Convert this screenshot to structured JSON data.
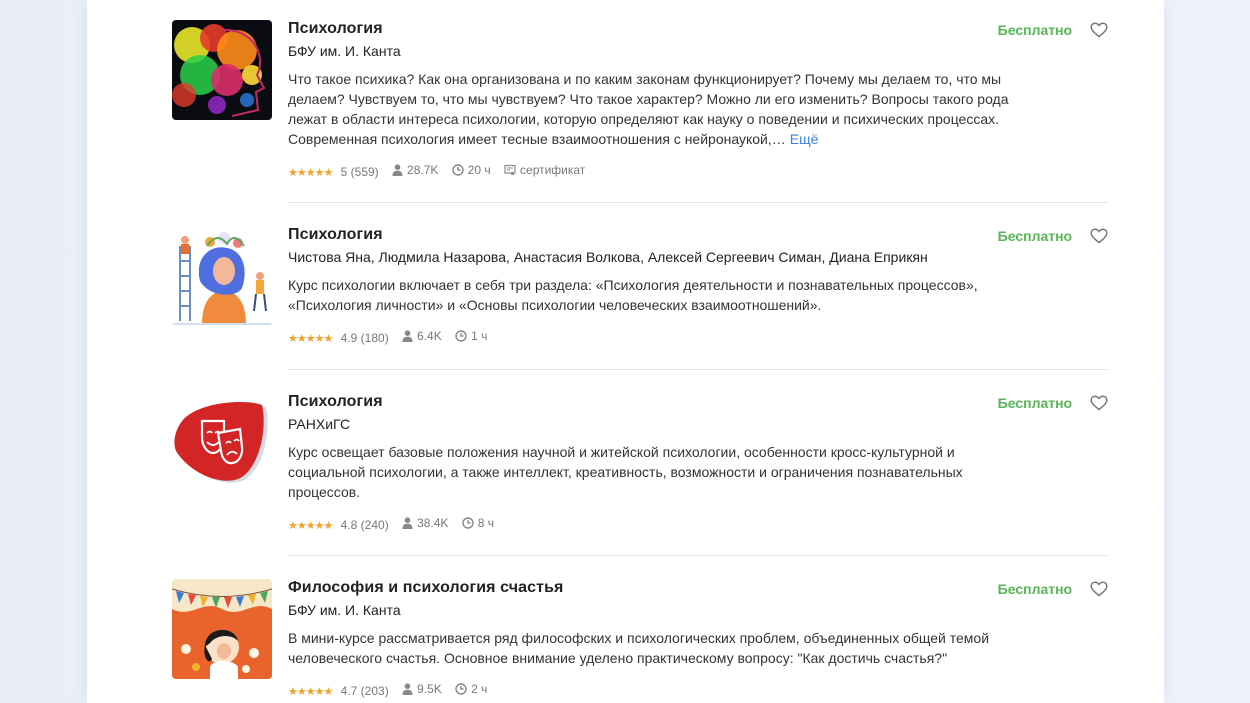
{
  "courses": [
    {
      "title": "Психология",
      "author": "БФУ им. И. Канта",
      "description": "Что такое психика? Как она организована и по каким законам функционирует? Почему мы делаем то, что мы делаем? Чувствуем то, что мы чувствуем? Что такое характер? Можно ли его изменить? Вопросы такого рода лежат в области интереса психологии, которую определяют как науку о поведении и психических процессах. Современная психология имеет тесные взаимоотношения с нейронаукой,…",
      "more": "Ещё",
      "price": "Бесплатно",
      "stars": "★★★★★",
      "rating": "5 (559)",
      "learners": "28.7K",
      "duration": "20 ч",
      "certificate": "сертификат"
    },
    {
      "title": "Психология",
      "author": "Чистова Яна, Людмила Назарова, Анастасия Волкова, Алексей Сергеевич Симан, Диана Еприкян",
      "description": "Курс психологии включает в себя три раздела: «Психология деятельности и познавательных процессов», «Психология личности» и «Основы психологии человеческих взаимоотношений».",
      "price": "Бесплатно",
      "stars": "★★★★★",
      "rating": "4.9 (180)",
      "learners": "6.4K",
      "duration": "1 ч"
    },
    {
      "title": "Психология",
      "author": "РАНХиГС",
      "description": "Курс освещает базовые положения научной и житейской психологии, особенности кросс-культурной и социальной психологии, а также интеллект, креативность, возможности и ограничения познавательных процессов.",
      "price": "Бесплатно",
      "stars": "★★★★★",
      "rating": "4.8 (240)",
      "learners": "38.4K",
      "duration": "8 ч"
    },
    {
      "title": "Философия и психология счастья",
      "author": "БФУ им. И. Канта",
      "description": "В мини-курсе рассматривается ряд философских и психологических проблем, объединенных общей темой человеческого счастья. Основное внимание уделено практическому вопросу: \"Как достичь счастья?\"",
      "price": "Бесплатно",
      "stars": "★★★★★",
      "rating": "4.7 (203)",
      "learners": "9.5K",
      "duration": "2 ч"
    }
  ],
  "colors": {
    "price": "#57b657",
    "stars": "#f2a12a",
    "link": "#3b82e0"
  },
  "icons": [
    "heart-icon",
    "person-icon",
    "clock-icon",
    "certificate-icon"
  ]
}
